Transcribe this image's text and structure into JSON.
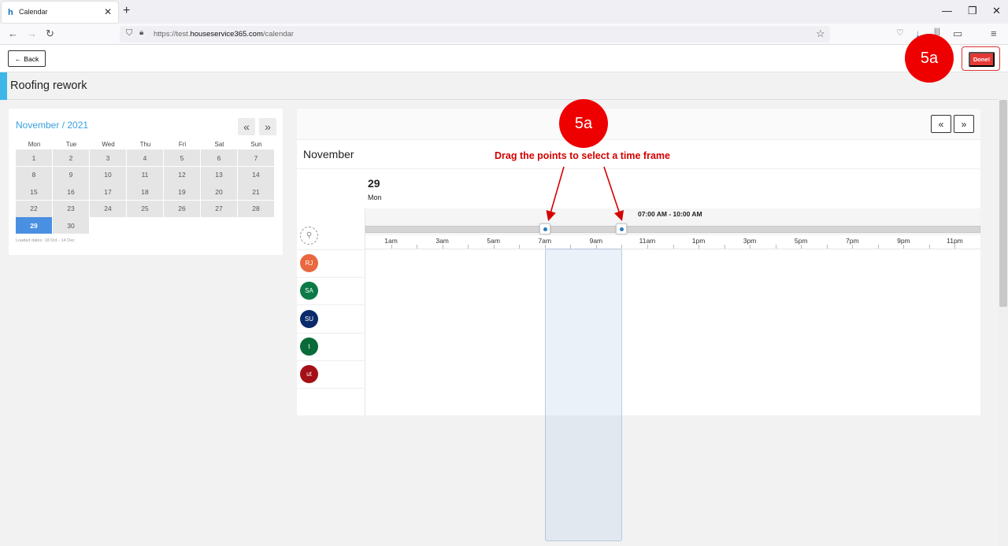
{
  "browser": {
    "tab_title": "Calendar",
    "favicon": "h",
    "url_prefix": "https://test.",
    "url_domain": "houseservice365.com",
    "url_path": "/calendar"
  },
  "app": {
    "back_label": "Back",
    "done_label": "Done!",
    "page_title": "Roofing rework",
    "callout_top": "5a",
    "callout_mid": "5a",
    "annotation": "Drag the points to select a time frame"
  },
  "mini_calendar": {
    "title": "November / 2021",
    "prev_symbol": "«",
    "next_symbol": "»",
    "weekdays": [
      "Mon",
      "Tue",
      "Wed",
      "Thu",
      "Fri",
      "Sat",
      "Sun"
    ],
    "days": [
      "1",
      "2",
      "3",
      "4",
      "5",
      "6",
      "7",
      "8",
      "9",
      "10",
      "11",
      "12",
      "13",
      "14",
      "15",
      "16",
      "17",
      "18",
      "19",
      "20",
      "21",
      "22",
      "23",
      "24",
      "25",
      "26",
      "27",
      "28",
      "29",
      "30"
    ],
    "selected_day": "29",
    "loaded_dates": "Loaded dates: 18 Oct - 14 Dec"
  },
  "scheduler": {
    "month": "November",
    "day_number": "29",
    "day_name": "Mon",
    "range_label": "07:00 AM - 10:00 AM",
    "range_start_hour": 7,
    "range_end_hour": 10,
    "hour_labels": [
      "1am",
      "3am",
      "5am",
      "7am",
      "9am",
      "11am",
      "1pm",
      "3pm",
      "5pm",
      "7pm",
      "9pm",
      "11pm"
    ],
    "resources": [
      {
        "initials": "",
        "color": "#ffffff",
        "icon": "unassigned-user-icon"
      },
      {
        "initials": "RJ",
        "color": "#e8683f"
      },
      {
        "initials": "SA",
        "color": "#0a7a47"
      },
      {
        "initials": "SU",
        "color": "#0b2a6b"
      },
      {
        "initials": "t",
        "color": "#0a6b3a"
      },
      {
        "initials": "ut",
        "color": "#a31015"
      }
    ]
  },
  "colors": {
    "accent": "#3db6e9",
    "done_red": "#e53935",
    "callout_red": "#ee0000",
    "selected_day": "#4a90e2"
  }
}
